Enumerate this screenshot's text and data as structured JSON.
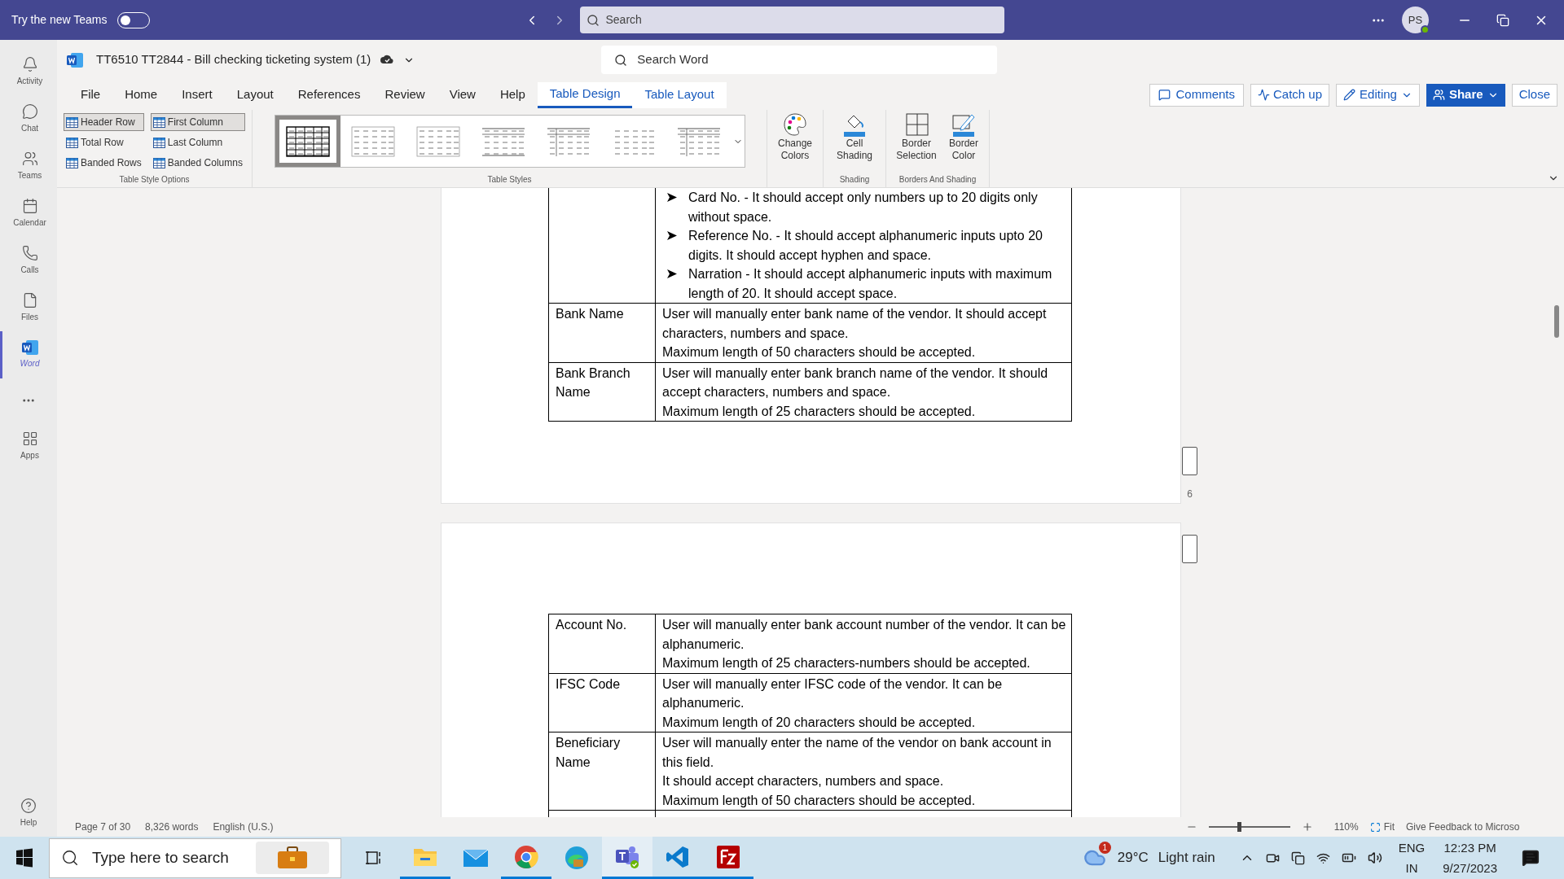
{
  "teams_bar": {
    "toggle_label": "Try the new Teams",
    "toggle_on": false,
    "search_placeholder": "Search",
    "avatar": "PS"
  },
  "rail": [
    {
      "label": "Activity",
      "selected": false
    },
    {
      "label": "Chat",
      "selected": false
    },
    {
      "label": "Teams",
      "selected": false
    },
    {
      "label": "Calendar",
      "selected": false
    },
    {
      "label": "Calls",
      "selected": false
    },
    {
      "label": "Files",
      "selected": false
    },
    {
      "label": "Word",
      "selected": true
    },
    {
      "label": "Apps",
      "selected": false
    }
  ],
  "help": "Help",
  "document": {
    "title": "TT6510 TT2844 - Bill checking ticketing system (1)",
    "search_placeholder": "Search Word"
  },
  "ribbon_tabs": [
    {
      "label": "File",
      "selected": false
    },
    {
      "label": "Home",
      "selected": false
    },
    {
      "label": "Insert",
      "selected": false
    },
    {
      "label": "Layout",
      "selected": false
    },
    {
      "label": "References",
      "selected": false
    },
    {
      "label": "Review",
      "selected": false
    },
    {
      "label": "View",
      "selected": false
    },
    {
      "label": "Help",
      "selected": false
    },
    {
      "label": "Table Design",
      "selected": true
    },
    {
      "label": "Table Layout",
      "selected": false
    }
  ],
  "actions": {
    "comments": "Comments",
    "catch_up": "Catch up",
    "editing": "Editing",
    "share": "Share",
    "close": "Close"
  },
  "style_options": [
    {
      "label": "Header Row",
      "checked": true
    },
    {
      "label": "First Column",
      "checked": true
    },
    {
      "label": "Total Row",
      "checked": false
    },
    {
      "label": "Last Column",
      "checked": false
    },
    {
      "label": "Banded Rows",
      "checked": false
    },
    {
      "label": "Banded Columns",
      "checked": false
    }
  ],
  "group_labels": {
    "options": "Table Style Options",
    "styles": "Table Styles",
    "shading": "Shading",
    "borders": "Borders And Shading"
  },
  "table_styles": [
    {
      "selected": true
    },
    {
      "selected": false
    },
    {
      "selected": false
    },
    {
      "selected": false
    },
    {
      "selected": false
    },
    {
      "selected": false
    },
    {
      "selected": false
    }
  ],
  "ribbon_buttons": {
    "change_colors": "Change Colors",
    "cell_shading": "Cell Shading",
    "border_selection": "Border Selection",
    "border_color": "Border Color"
  },
  "page_1": {
    "rows": [
      {
        "field": "",
        "bullets": [
          "Card No. - It should accept only numbers up to 20 digits only without space.",
          "Reference No. - It should accept alphanumeric inputs upto 20 digits. It should accept hyphen and space.",
          "Narration -  It should accept alphanumeric inputs with maximum length of 20. It should accept space."
        ]
      },
      {
        "field": "Bank Name",
        "paragraphs": [
          "User will manually enter bank name of the vendor. It should accept characters, numbers and space.",
          "Maximum length of 50 characters should be accepted."
        ]
      },
      {
        "field": "Bank Branch Name",
        "paragraphs": [
          "User will manually enter bank branch name of the vendor. It should accept characters, numbers and space.",
          "Maximum length of 25 characters should be accepted."
        ]
      }
    ],
    "page_number": "6"
  },
  "page_2": {
    "rows": [
      {
        "field": "Account No.",
        "paragraphs": [
          "User will manually enter bank account number of the vendor. It can be alphanumeric.",
          "Maximum length of 25 characters-numbers should be accepted."
        ]
      },
      {
        "field": "IFSC Code",
        "paragraphs": [
          "User will manually enter IFSC code of the vendor. It can be alphanumeric.",
          "Maximum length of 20 characters should be accepted."
        ]
      },
      {
        "field": "Beneficiary Name",
        "paragraphs": [
          "User will manually enter the name of the vendor on bank account in this field.",
          "It should accept characters, numbers and space.",
          "Maximum length of 50 characters should be accepted."
        ]
      }
    ]
  },
  "status_bar": {
    "page": "Page 7 of 30",
    "words": "8,326 words",
    "language": "English (U.S.)",
    "zoom_slider": {
      "level": 0.35
    },
    "zoom": "110%",
    "fit": "Fit",
    "feedback": "Give Feedback to Microso"
  },
  "taskbar": {
    "search_placeholder": "Type here to search",
    "weather_badge": "1",
    "temperature": "29°C",
    "weather": "Light rain",
    "language": "ENG",
    "region": "IN",
    "time": "12:23 PM",
    "date": "9/27/2023"
  }
}
